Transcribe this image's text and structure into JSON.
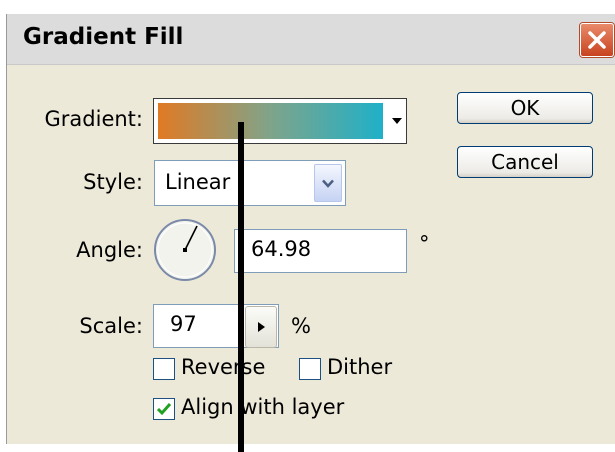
{
  "dialog": {
    "title": "Gradient Fill",
    "close_icon": "close-x-icon"
  },
  "gradient": {
    "label": "Gradient:",
    "colors": [
      "#e07a24",
      "#7fa48a",
      "#1fb0c8"
    ]
  },
  "style": {
    "label": "Style:",
    "value": "Linear"
  },
  "angle": {
    "label": "Angle:",
    "value": "64.98",
    "unit": "°"
  },
  "scale": {
    "label": "Scale:",
    "value": "97",
    "unit": "%"
  },
  "options": {
    "reverse": {
      "label": "Reverse",
      "checked": false
    },
    "dither": {
      "label": "Dither",
      "checked": false
    },
    "align": {
      "label": "Align with layer",
      "checked": true
    }
  },
  "buttons": {
    "ok": "OK",
    "cancel": "Cancel"
  },
  "colors": {
    "dialog_bg": "#ece9d8",
    "close_red": "#c8431f",
    "button_border": "#003c74",
    "checkmark_green": "#21a121"
  }
}
